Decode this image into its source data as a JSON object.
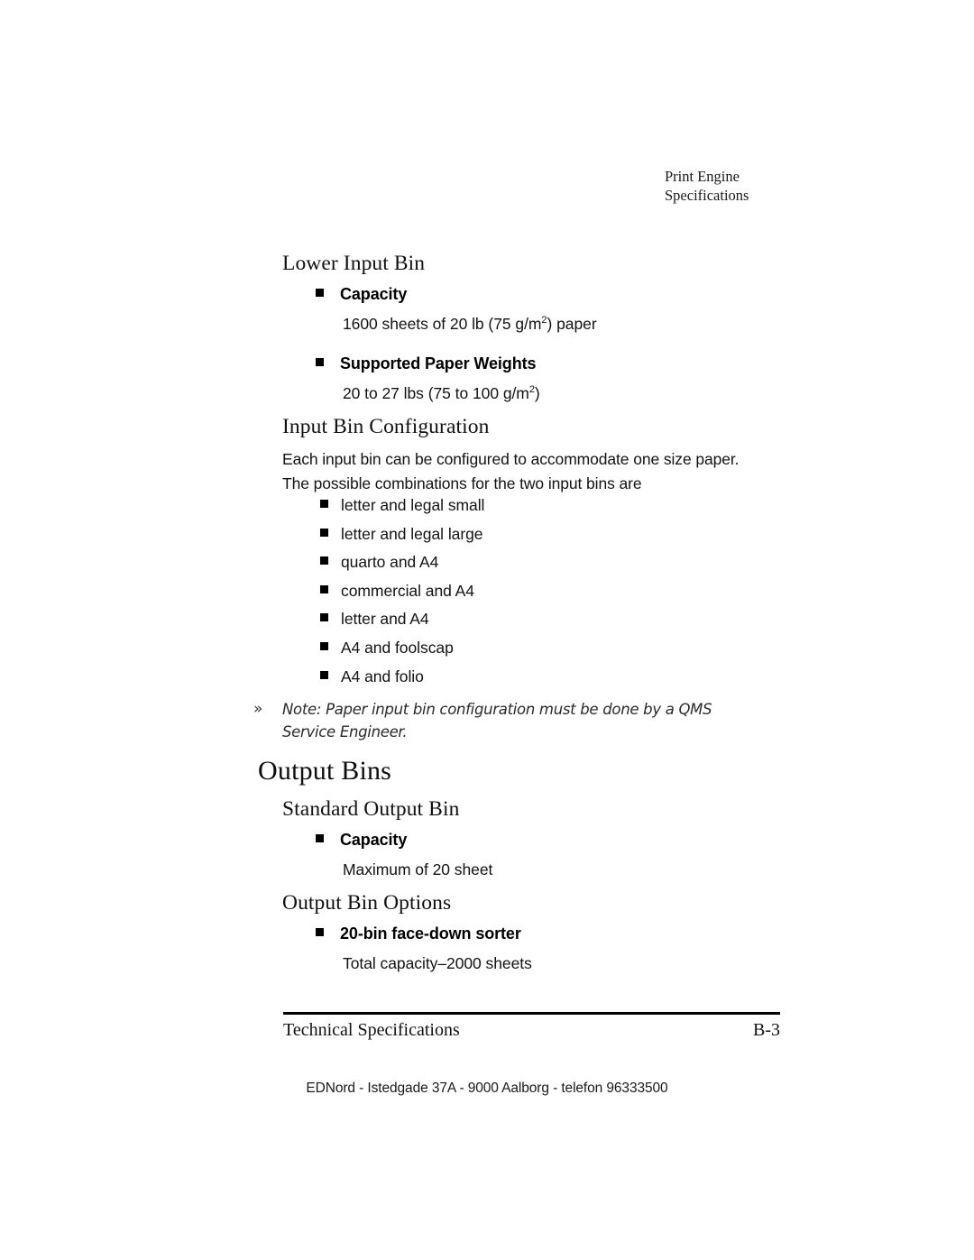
{
  "header": {
    "line1": "Print Engine",
    "line2": "Specifications"
  },
  "sections": {
    "lower_input_bin": {
      "heading": "Lower Input Bin",
      "capacity_term": "Capacity",
      "capacity_value_pre": "1600 sheets of 20 lb (75 g/m",
      "capacity_value_sup": "2",
      "capacity_value_post": ") paper",
      "weights_term": "Supported Paper Weights",
      "weights_value_pre": "20 to 27 lbs (75 to 100 g/m",
      "weights_value_sup": "2",
      "weights_value_post": ")"
    },
    "input_bin_configuration": {
      "heading": "Input Bin Configuration",
      "intro_line1": "Each input bin can be configured to accommodate one size paper.",
      "intro_line2": "The possible combinations for the two input bins are",
      "combinations": [
        "letter and legal small",
        "letter and legal large",
        "quarto and A4",
        "commercial and A4",
        "letter and A4",
        "A4 and foolscap",
        "A4 and folio"
      ],
      "note_marker": "»",
      "note_text": "Note: Paper input bin configuration must be done by a QMS Service Engineer."
    },
    "output_bins": {
      "heading": "Output Bins",
      "standard_output_bin": {
        "heading": "Standard Output Bin",
        "capacity_term": "Capacity",
        "capacity_value": "Maximum of 20 sheet"
      },
      "output_bin_options": {
        "heading": "Output Bin Options",
        "sorter_term": "20-bin face-down sorter",
        "sorter_value": "Total capacity–2000 sheets"
      }
    }
  },
  "footer": {
    "left": "Technical Specifications",
    "right": "B-3",
    "imprint": "EDNord - Istedgade 37A - 9000 Aalborg - telefon 96333500"
  }
}
